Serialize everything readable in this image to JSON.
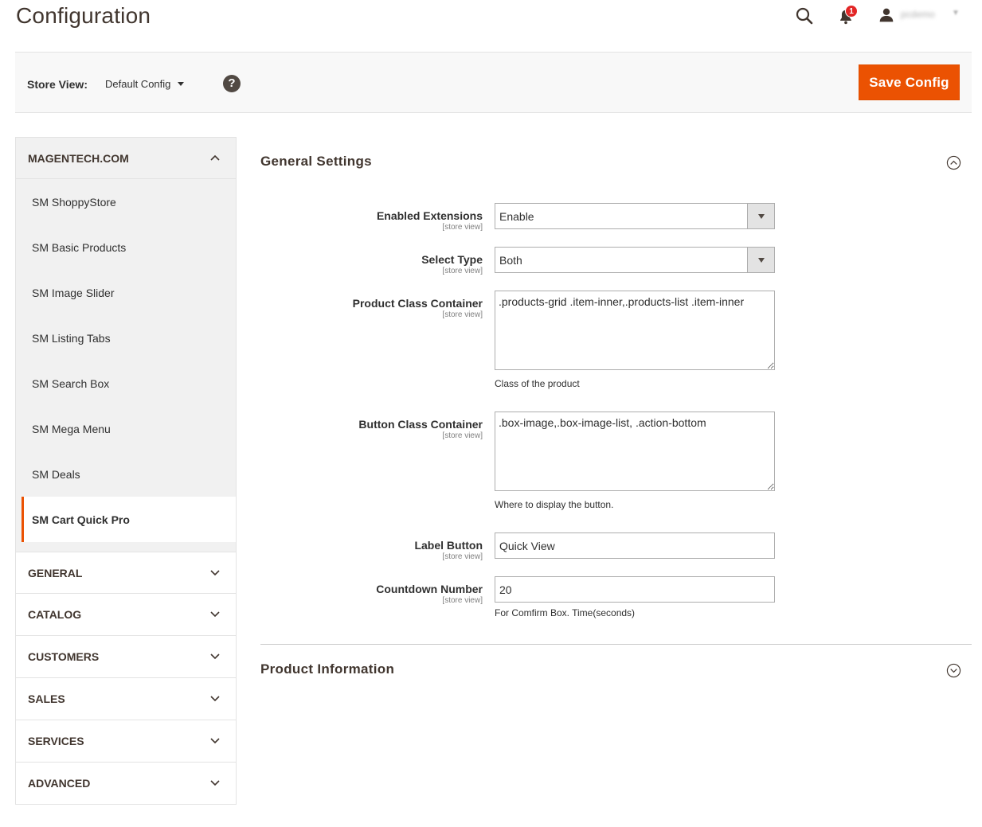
{
  "page": {
    "title": "Configuration"
  },
  "header": {
    "notifications_count": "1",
    "user_name": "pcdemo",
    "icons": [
      "search-icon",
      "bell-icon",
      "user-icon",
      "chevron-down-icon"
    ]
  },
  "store_bar": {
    "label": "Store View:",
    "value": "Default Config",
    "help": "?",
    "save_label": "Save Config"
  },
  "sidebar": {
    "active_section": "MAGENTECH.COM",
    "active_items": [
      "SM ShoppyStore",
      "SM Basic Products",
      "SM Image Slider",
      "SM Listing Tabs",
      "SM Search Box",
      "SM Mega Menu",
      "SM Deals",
      "SM Cart Quick Pro"
    ],
    "current_item": "SM Cart Quick Pro",
    "sections": [
      "GENERAL",
      "CATALOG",
      "CUSTOMERS",
      "SALES",
      "SERVICES",
      "ADVANCED"
    ]
  },
  "main": {
    "group1_title": "General Settings",
    "group2_title": "Product Information",
    "scope_text": "[store view]",
    "fields": {
      "enabled": {
        "label": "Enabled Extensions",
        "value": "Enable"
      },
      "select_type": {
        "label": "Select Type",
        "value": "Both"
      },
      "product_class": {
        "label": "Product Class Container",
        "value": ".products-grid .item-inner,.products-list .item-inner",
        "note": "Class of the product"
      },
      "button_class": {
        "label": "Button Class Container",
        "value": ".box-image,.box-image-list, .action-bottom",
        "note": "Where to display the button."
      },
      "label_button": {
        "label": "Label Button",
        "value": "Quick View"
      },
      "countdown": {
        "label": "Countdown Number",
        "value": "20",
        "note": "For Comfirm Box. Time(seconds)"
      }
    }
  },
  "colors": {
    "accent": "#eb5202",
    "heading": "#41362f",
    "text": "#303030"
  }
}
